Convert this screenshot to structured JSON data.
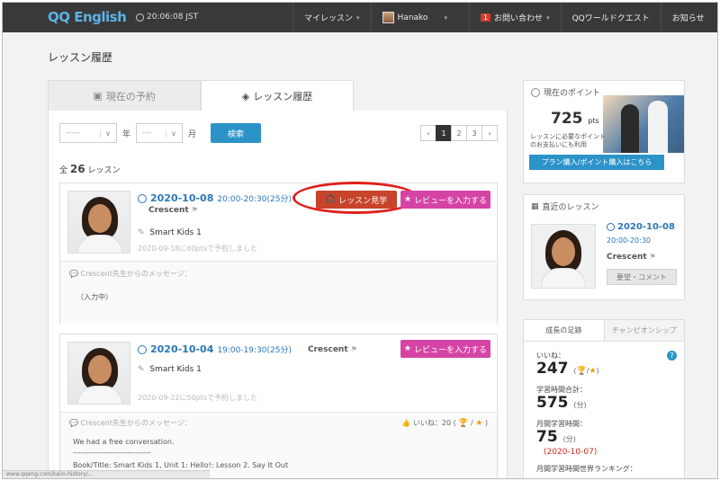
{
  "header": {
    "logo": "QQ English",
    "clock": "20:06:08 JST",
    "nav": {
      "my_lesson": "マイレッスン",
      "user": "Hanako",
      "inquiry_badge": "1",
      "inquiry": "お問い合わせ",
      "quest": "QQワールドクエスト",
      "news": "お知らせ"
    }
  },
  "page_title": "レッスン履歴",
  "tabs": {
    "reservations": "現在の予約",
    "history": "レッスン履歴"
  },
  "filters": {
    "year_value": "-----",
    "year_label": "年",
    "month_value": "---",
    "month_label": "月",
    "search_label": "検索"
  },
  "pagination": {
    "prev": "‹",
    "pages": [
      "1",
      "2",
      "3"
    ],
    "next": "›"
  },
  "total": {
    "prefix": "全",
    "count": "26",
    "suffix": "レッスン"
  },
  "lessons": [
    {
      "date": "2020-10-08",
      "time": "20:00-20:30(25分)",
      "teacher": "Crescent",
      "course": "Smart Kids 1",
      "booked": "2020-09-18に60ptsで予約しました",
      "watch_label": "レッスン見学",
      "review_label": "レビューを入力する",
      "message_label": "Crescent先生からのメッセージ：",
      "message_body": "（入力中）"
    },
    {
      "date": "2020-10-04",
      "time": "19:00-19:30(25分)",
      "teacher": "Crescent",
      "course": "Smart Kids 1",
      "booked": "2020-09-22に50ptsで予約しました",
      "review_label": "レビューを入力する",
      "message_label": "Crescent先生からのメッセージ：",
      "likes": "いいね：20 (",
      "message_lines": [
        "We had a free conversation.",
        "------------------------------",
        "Book/Title: Smart Kids 1, Unit 1: Hello!: Lesson 2. Say It Out"
      ]
    }
  ],
  "points": {
    "header": "現在のポイント",
    "value": "725",
    "unit": "pts",
    "promo_text": "レッスンに必要なポイント のお支払いにも利用",
    "buy_label": "プラン購入/ポイント購入はこちら"
  },
  "recent": {
    "header": "直近のレッスン",
    "date": "2020-10-08",
    "time": "20:00-20:30",
    "teacher": "Crescent",
    "request_label": "要望・コメント"
  },
  "growth": {
    "tab_growth": "成長の足跡",
    "tab_champion": "チャンピオンシップ",
    "likes_label": "いいね：",
    "likes_value": "247",
    "study_label": "学習時間合計：",
    "study_value": "575",
    "study_unit": "(分)",
    "monthly_label": "月間学習時間：",
    "monthly_value": "75",
    "monthly_unit": "(分)",
    "monthly_date": "(2020-10-07)",
    "ranking_label": "月間学習時間世界ランキング："
  },
  "statusbar": "www.qqeng.com/kaiin-history/..."
}
